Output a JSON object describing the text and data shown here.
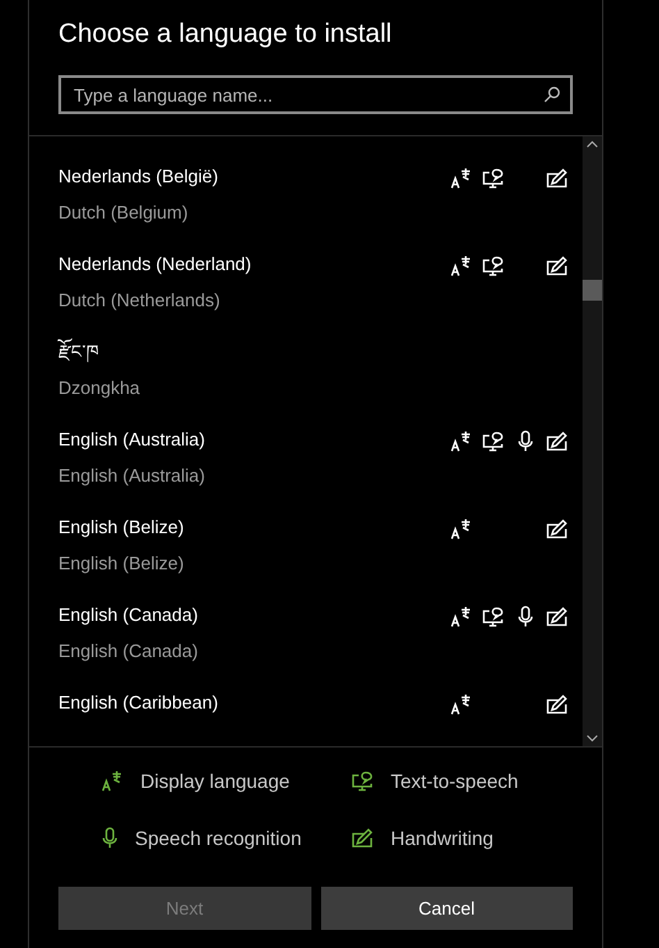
{
  "dialog": {
    "title": "Choose a language to install",
    "search": {
      "placeholder": "Type a language name..."
    },
    "languages": [
      {
        "name": "Nederlands (België)",
        "english": "Dutch (Belgium)",
        "display_language": true,
        "text_to_speech": true,
        "speech_recognition": false,
        "handwriting": true
      },
      {
        "name": "Nederlands (Nederland)",
        "english": "Dutch (Netherlands)",
        "display_language": true,
        "text_to_speech": true,
        "speech_recognition": false,
        "handwriting": true
      },
      {
        "name": "རྫོང་ཁ",
        "english": "Dzongkha",
        "display_language": false,
        "text_to_speech": false,
        "speech_recognition": false,
        "handwriting": false
      },
      {
        "name": "English (Australia)",
        "english": "English (Australia)",
        "display_language": true,
        "text_to_speech": true,
        "speech_recognition": true,
        "handwriting": true
      },
      {
        "name": "English (Belize)",
        "english": "English (Belize)",
        "display_language": true,
        "text_to_speech": false,
        "speech_recognition": false,
        "handwriting": true
      },
      {
        "name": "English (Canada)",
        "english": "English (Canada)",
        "display_language": true,
        "text_to_speech": true,
        "speech_recognition": true,
        "handwriting": true
      },
      {
        "name": "English (Caribbean)",
        "display_language": true,
        "text_to_speech": false,
        "speech_recognition": false,
        "handwriting": true
      }
    ],
    "legend": [
      {
        "kind": "display",
        "label": "Display language"
      },
      {
        "kind": "tts",
        "label": "Text-to-speech"
      },
      {
        "kind": "speech",
        "label": "Speech recognition"
      },
      {
        "kind": "handwriting",
        "label": "Handwriting"
      }
    ],
    "buttons": [
      {
        "label": "Next",
        "disabled": true
      },
      {
        "label": "Cancel",
        "disabled": false
      }
    ]
  }
}
